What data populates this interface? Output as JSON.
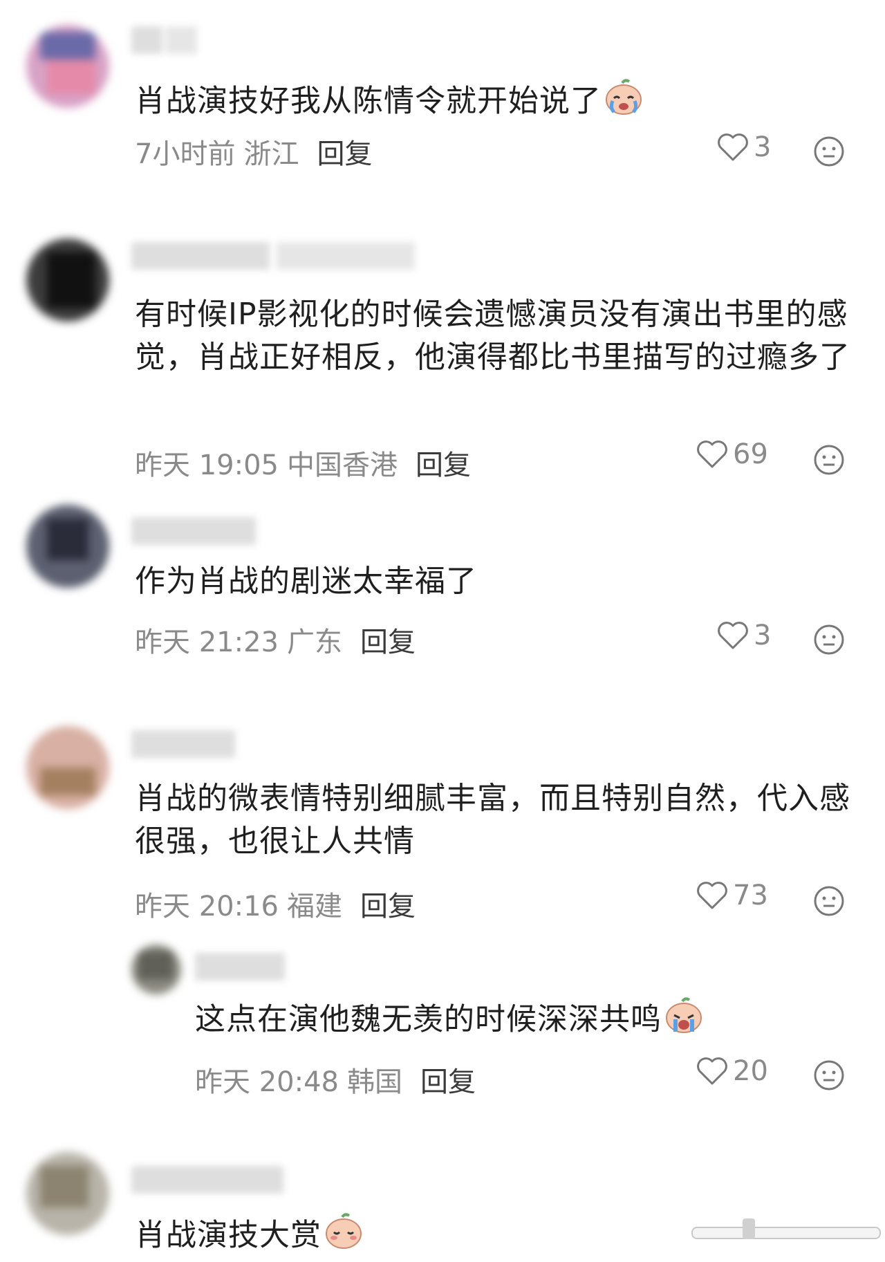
{
  "comments": [
    {
      "text": "肖战演技好我从陈情令就开始说了",
      "time": "7小时前",
      "location": "浙江",
      "reply": "回复",
      "likes": "3",
      "emoji": "crying-emoji"
    },
    {
      "text": "有时候IP影视化的时候会遗憾演员没有演出书里的感觉，肖战正好相反，他演得都比书里描写的过瘾多了",
      "time": "昨天 19:05",
      "location": "中国香港",
      "reply": "回复",
      "likes": "69"
    },
    {
      "text": "作为肖战的剧迷太幸福了",
      "time": "昨天 21:23",
      "location": "广东",
      "reply": "回复",
      "likes": "3"
    },
    {
      "text": "肖战的微表情特别细腻丰富，而且特别自然，代入感很强，也很让人共情",
      "time": "昨天 20:16",
      "location": "福建",
      "reply": "回复",
      "likes": "73"
    },
    {
      "text": "这点在演他魏无羡的时候深深共鸣",
      "time": "昨天 20:48",
      "location": "韩国",
      "reply": "回复",
      "likes": "20",
      "emoji": "sobbing-emoji"
    },
    {
      "text": "肖战演技大赏",
      "emoji": "blushing-emoji"
    }
  ],
  "colors": {
    "text": "#1f1f1f",
    "meta": "#8a8a8a",
    "reply": "#3a3a3a"
  }
}
